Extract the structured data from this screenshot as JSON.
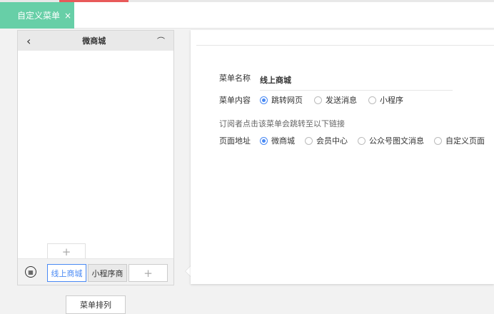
{
  "tab": {
    "label": "自定义菜单",
    "close": "×"
  },
  "phone": {
    "title": "微商城",
    "back": "‹",
    "user": "⌒",
    "sub_add": "+",
    "menus": [
      "线上商城",
      "小程序商"
    ],
    "add": "+"
  },
  "form": {
    "name_label": "菜单名称",
    "name_value": "线上商城",
    "content_label": "菜单内容",
    "content_options": [
      "跳转网页",
      "发送消息",
      "小程序"
    ],
    "hint": "订阅者点击该菜单会跳转至以下链接",
    "url_label": "页面地址",
    "url_options": [
      "微商城",
      "会员中心",
      "公众号图文消息",
      "自定义页面"
    ]
  },
  "sort_button": "菜单排列",
  "colors": {
    "accent": "#67cfa7",
    "radio": "#4a8af4"
  }
}
